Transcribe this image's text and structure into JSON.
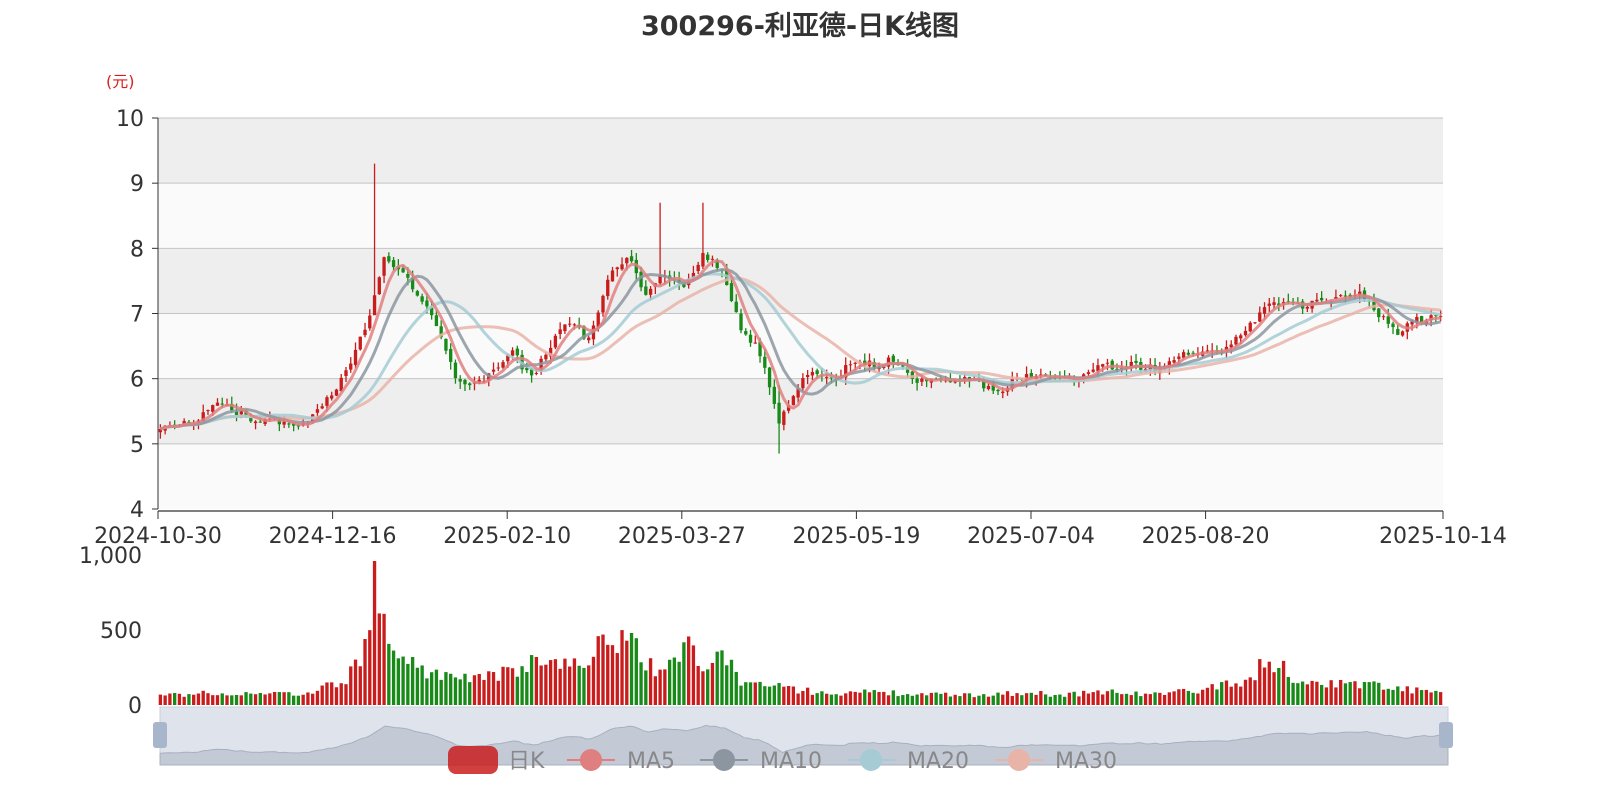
{
  "chart_data": {
    "type": "candlestick",
    "title": "300296-利亚德-日K线图",
    "y_unit": "(元)",
    "price_axis": {
      "ylim": [
        4,
        10
      ],
      "ticks": [
        "10",
        "9",
        "8",
        "7",
        "6",
        "5",
        "4"
      ]
    },
    "volume_axis": {
      "ylim": [
        0,
        1000
      ],
      "ticks": [
        "1,000",
        "500",
        "0"
      ]
    },
    "x_tick_labels": [
      "2024-10-30",
      "2024-12-16",
      "2025-02-10",
      "2025-03-27",
      "2025-05-19",
      "2025-07-04",
      "2025-08-20",
      "2025-10-14"
    ],
    "grid": true,
    "legend": {
      "position": "bottom",
      "items": [
        "日K",
        "MA5",
        "MA10",
        "MA20",
        "MA30"
      ]
    },
    "colors": {
      "up": "#c91d1d",
      "down": "#188a18",
      "ma5": "#e07f7f",
      "ma10": "#8c96a0",
      "ma20": "#a6cbd4",
      "ma30": "#e8b4a8"
    },
    "close_anchors": [
      [
        0,
        5.2
      ],
      [
        8,
        5.4
      ],
      [
        12,
        5.65
      ],
      [
        18,
        5.4
      ],
      [
        24,
        5.35
      ],
      [
        30,
        5.3
      ],
      [
        36,
        5.75
      ],
      [
        40,
        6.2
      ],
      [
        44,
        7.0
      ],
      [
        47,
        7.9
      ],
      [
        50,
        7.7
      ],
      [
        54,
        7.3
      ],
      [
        58,
        6.8
      ],
      [
        62,
        6.0
      ],
      [
        66,
        5.9
      ],
      [
        70,
        6.1
      ],
      [
        74,
        6.4
      ],
      [
        78,
        6.0
      ],
      [
        82,
        6.5
      ],
      [
        86,
        6.9
      ],
      [
        90,
        6.6
      ],
      [
        94,
        7.5
      ],
      [
        98,
        7.9
      ],
      [
        102,
        7.3
      ],
      [
        106,
        7.6
      ],
      [
        110,
        7.4
      ],
      [
        114,
        7.9
      ],
      [
        118,
        7.7
      ],
      [
        122,
        6.8
      ],
      [
        126,
        6.4
      ],
      [
        130,
        5.3
      ],
      [
        134,
        5.9
      ],
      [
        138,
        6.1
      ],
      [
        142,
        6.0
      ],
      [
        146,
        6.3
      ],
      [
        150,
        6.2
      ],
      [
        154,
        6.3
      ],
      [
        158,
        6.0
      ],
      [
        162,
        5.95
      ],
      [
        170,
        6.0
      ],
      [
        176,
        5.8
      ],
      [
        180,
        6.0
      ],
      [
        186,
        6.05
      ],
      [
        192,
        6.0
      ],
      [
        198,
        6.2
      ],
      [
        204,
        6.2
      ],
      [
        210,
        6.15
      ],
      [
        216,
        6.4
      ],
      [
        222,
        6.4
      ],
      [
        228,
        6.7
      ],
      [
        232,
        7.1
      ],
      [
        236,
        7.2
      ],
      [
        240,
        7.1
      ],
      [
        244,
        7.2
      ],
      [
        248,
        7.3
      ],
      [
        252,
        7.3
      ],
      [
        256,
        7.0
      ],
      [
        260,
        6.7
      ],
      [
        264,
        6.9
      ],
      [
        268,
        6.95
      ],
      [
        269,
        6.9
      ]
    ],
    "volume_anchors": [
      [
        0,
        65
      ],
      [
        10,
        80
      ],
      [
        20,
        70
      ],
      [
        30,
        75
      ],
      [
        38,
        150
      ],
      [
        42,
        280
      ],
      [
        44,
        440
      ],
      [
        45,
        960
      ],
      [
        46,
        620
      ],
      [
        47,
        580
      ],
      [
        48,
        420
      ],
      [
        52,
        280
      ],
      [
        60,
        190
      ],
      [
        70,
        180
      ],
      [
        74,
        240
      ],
      [
        78,
        280
      ],
      [
        84,
        260
      ],
      [
        90,
        320
      ],
      [
        94,
        420
      ],
      [
        98,
        480
      ],
      [
        102,
        300
      ],
      [
        106,
        200
      ],
      [
        110,
        380
      ],
      [
        112,
        480
      ],
      [
        114,
        200
      ],
      [
        118,
        360
      ],
      [
        122,
        160
      ],
      [
        126,
        140
      ],
      [
        130,
        120
      ],
      [
        134,
        100
      ],
      [
        140,
        80
      ],
      [
        150,
        85
      ],
      [
        160,
        70
      ],
      [
        170,
        65
      ],
      [
        180,
        80
      ],
      [
        190,
        70
      ],
      [
        200,
        90
      ],
      [
        210,
        70
      ],
      [
        220,
        110
      ],
      [
        228,
        160
      ],
      [
        232,
        280
      ],
      [
        236,
        240
      ],
      [
        240,
        140
      ],
      [
        250,
        150
      ],
      [
        260,
        110
      ],
      [
        269,
        80
      ]
    ],
    "candle_count": 270
  }
}
